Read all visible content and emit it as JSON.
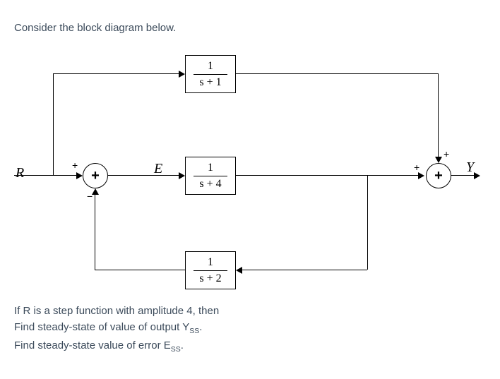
{
  "intro": "Consider the block diagram below.",
  "signals": {
    "R": "R",
    "E": "E",
    "Y": "Y"
  },
  "blocks": {
    "top": {
      "num": "1",
      "den": "s + 1"
    },
    "mid": {
      "num": "1",
      "den": "s + 4"
    },
    "bot": {
      "num": "1",
      "den": "s + 2"
    }
  },
  "sums": {
    "left": {
      "symbol": "+",
      "top_sign": "+",
      "bottom_sign": "−"
    },
    "right": {
      "symbol": "+",
      "top_sign": "+",
      "left_sign": "+"
    }
  },
  "footer": {
    "l1": "If R is a step function with amplitude 4, then",
    "l2_a": "Find steady-state of value of output Y",
    "l2_sub": "SS",
    "l2_b": ".",
    "l3_a": "Find steady-state value of error E",
    "l3_sub": "SS",
    "l3_b": "."
  },
  "chart_data": {
    "type": "block-diagram",
    "input": "R",
    "output": "Y",
    "error_signal": "E",
    "input_description": "step function, amplitude 4",
    "nodes": [
      {
        "id": "sum1",
        "type": "sum",
        "inputs": [
          {
            "signal": "R",
            "sign": "+"
          },
          {
            "signal": "feedback",
            "sign": "-"
          }
        ],
        "output": "E"
      },
      {
        "id": "G1",
        "type": "transfer",
        "tf": "1/(s+1)",
        "input": "R",
        "output": "branch_top"
      },
      {
        "id": "G2",
        "type": "transfer",
        "tf": "1/(s+4)",
        "input": "E",
        "output": "branch_mid"
      },
      {
        "id": "H",
        "type": "transfer",
        "tf": "1/(s+2)",
        "input": "branch_mid",
        "output": "feedback"
      },
      {
        "id": "sum2",
        "type": "sum",
        "inputs": [
          {
            "signal": "branch_top",
            "sign": "+"
          },
          {
            "signal": "branch_mid",
            "sign": "+"
          }
        ],
        "output": "Y"
      }
    ],
    "tasks": [
      "steady-state value of output Y_ss",
      "steady-state value of error E_ss"
    ]
  }
}
